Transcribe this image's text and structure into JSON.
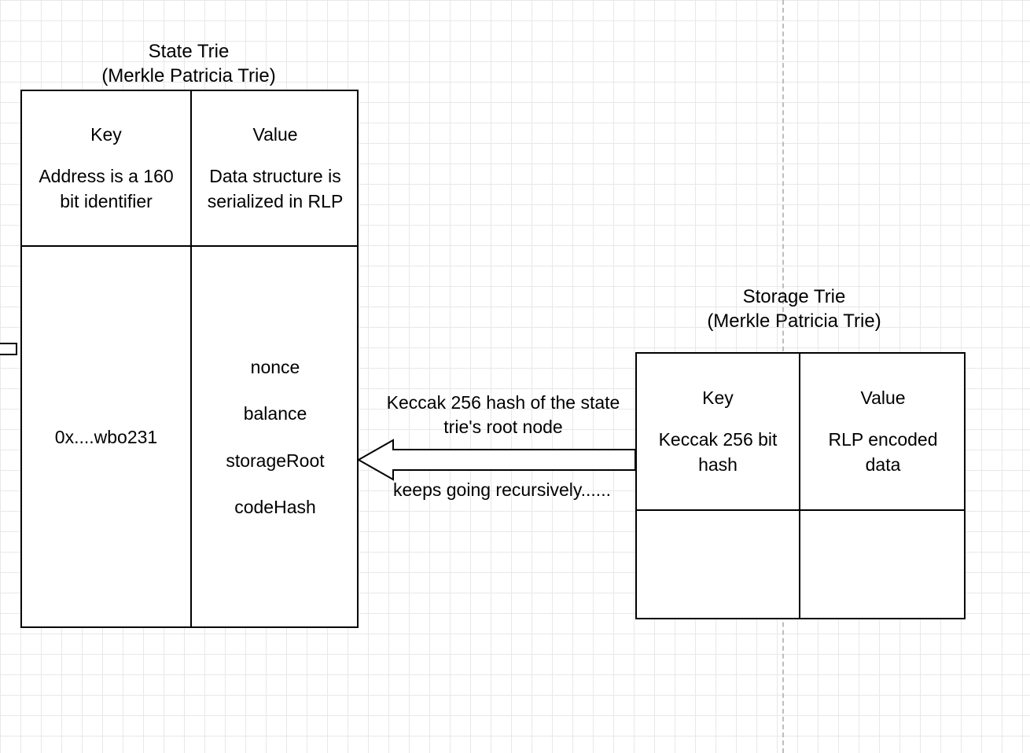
{
  "state_trie": {
    "title_line1": "State Trie",
    "title_line2": "(Merkle Patricia Trie)",
    "header": {
      "key_label": "Key",
      "key_desc": "Address is a 160 bit identifier",
      "value_label": "Value",
      "value_desc": "Data structure is serialized in RLP"
    },
    "row": {
      "key_example": "0x....wbo231",
      "value_fields": {
        "nonce": "nonce",
        "balance": "balance",
        "storageRoot": "storageRoot",
        "codeHash": "codeHash"
      }
    }
  },
  "storage_trie": {
    "title_line1": "Storage Trie",
    "title_line2": "(Merkle Patricia Trie)",
    "header": {
      "key_label": "Key",
      "key_desc": "Keccak 256 bit hash",
      "value_label": "Value",
      "value_desc": "RLP encoded data"
    }
  },
  "arrow": {
    "label_top": "Keccak 256 hash of the state trie's root node",
    "label_bottom": "keeps going recursively......"
  }
}
